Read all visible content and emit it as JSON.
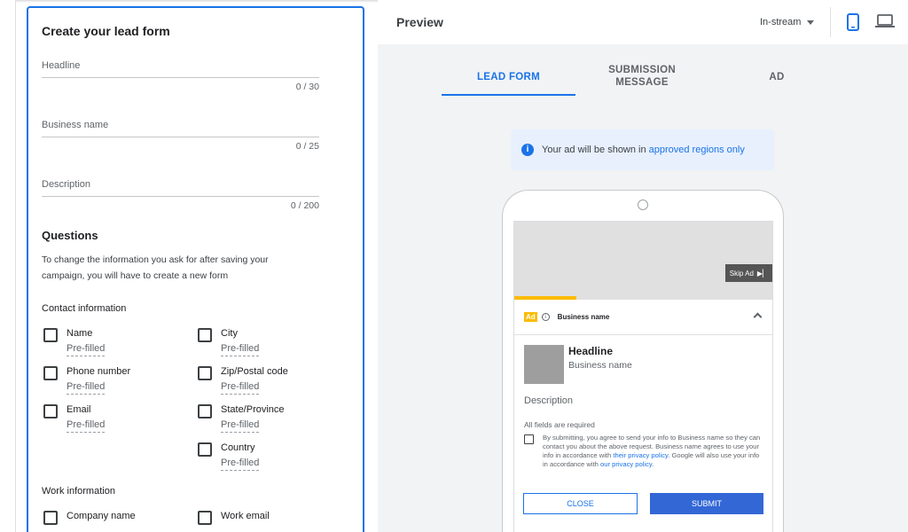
{
  "form": {
    "title": "Create your lead form",
    "fields": [
      {
        "label": "Headline",
        "counter": "0 / 30"
      },
      {
        "label": "Business name",
        "counter": "0 / 25"
      },
      {
        "label": "Description",
        "counter": "0 / 200"
      }
    ],
    "questions": {
      "heading": "Questions",
      "helper": "To change the information you ask for after saving your campaign, you will have to create a new form",
      "contact_heading": "Contact information",
      "contact_items": [
        {
          "label": "Name",
          "sub": "Pre-filled"
        },
        {
          "label": "Phone number",
          "sub": "Pre-filled"
        },
        {
          "label": "Email",
          "sub": "Pre-filled"
        },
        {
          "label": "City",
          "sub": "Pre-filled"
        },
        {
          "label": "Zip/Postal code",
          "sub": "Pre-filled"
        },
        {
          "label": "State/Province",
          "sub": "Pre-filled"
        },
        {
          "label": "Country",
          "sub": "Pre-filled"
        }
      ],
      "work_heading": "Work information",
      "work_items": [
        {
          "label": "Company name"
        },
        {
          "label": "Work email"
        }
      ]
    }
  },
  "preview": {
    "title": "Preview",
    "format_select": "In-stream",
    "device_icons": [
      "phone-icon",
      "laptop-icon"
    ],
    "tabs": [
      {
        "label": "LEAD FORM",
        "active": true
      },
      {
        "label": "SUBMISSION MESSAGE",
        "active": false
      },
      {
        "label": "AD",
        "active": false
      }
    ],
    "notice": {
      "icon": "info-icon",
      "text": "Your ad will be shown in",
      "link": "approved regions only"
    },
    "video": {
      "skip_label": "Skip Ad",
      "skip_glyph": "▶▏",
      "progress": 0.24
    },
    "ad_row": {
      "badge": "Ad",
      "info_glyph": "i",
      "business": "Business name"
    },
    "lead_form": {
      "headline": "Headline",
      "business": "Business name",
      "description": "Description",
      "required_note": "All fields are required",
      "consent_text": "By submitting, you agree to send your info to Business name so they can contact you about the above request. Business name agrees to use your info in accordance with",
      "consent_link1": "their privacy policy",
      "consent_mid": ". Google will also use your info in accordance with",
      "consent_link2": "our privacy policy",
      "consent_end": ".",
      "close_label": "CLOSE",
      "submit_label": "SUBMIT"
    }
  },
  "colors": {
    "accent": "#1a73e8",
    "ad_yellow": "#fbbc04",
    "submit_blue": "#3367d6",
    "preview_bg": "#f1f3f4"
  }
}
